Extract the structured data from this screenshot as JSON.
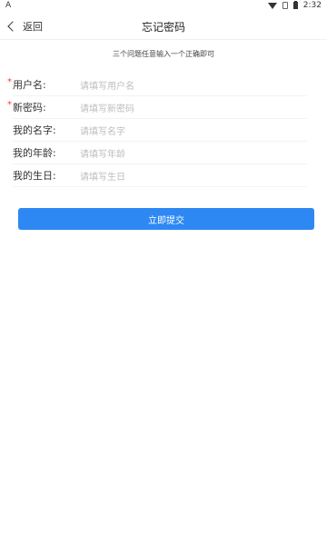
{
  "status_bar": {
    "time": "2:32"
  },
  "app_bar": {
    "back_label": "返回",
    "title": "忘记密码"
  },
  "hint": "三个问题任意输入一个正确即可",
  "form": {
    "rows": [
      {
        "required": true,
        "label": "用户名:",
        "placeholder": "请填写用户名"
      },
      {
        "required": true,
        "label": "新密码:",
        "placeholder": "请填写新密码"
      },
      {
        "required": false,
        "label": "我的名字:",
        "placeholder": "请填写名字"
      },
      {
        "required": false,
        "label": "我的年龄:",
        "placeholder": "请填写年龄"
      },
      {
        "required": false,
        "label": "我的生日:",
        "placeholder": "请填写生日"
      }
    ],
    "submit_label": "立即提交"
  }
}
